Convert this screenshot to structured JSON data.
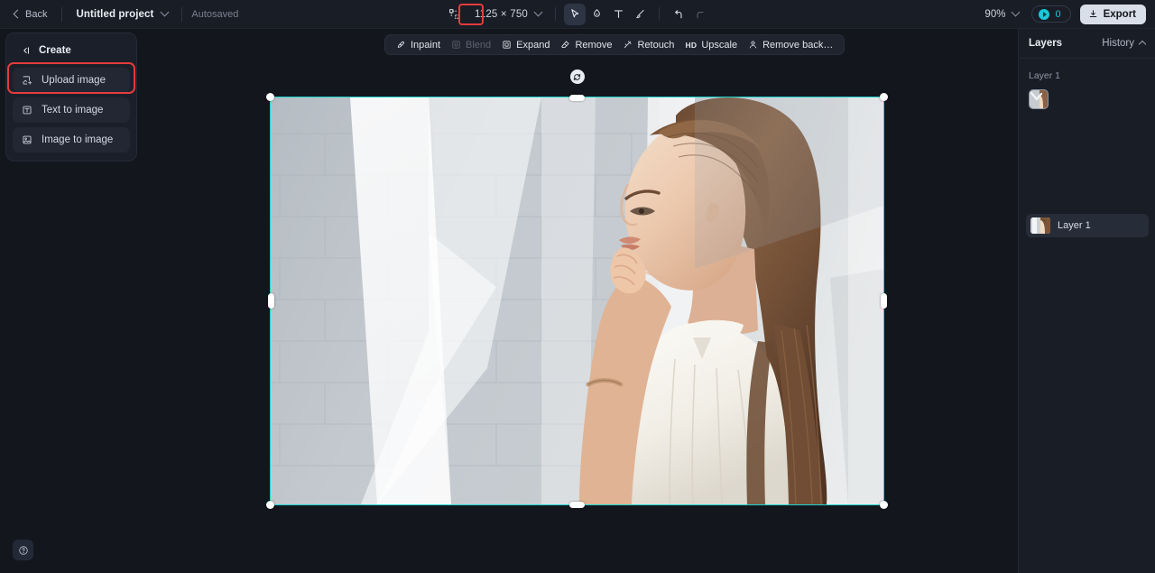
{
  "app": {
    "background": "#13161d",
    "accent": "#1ed4cf",
    "highlight_color": "#e33c3c"
  },
  "topbar": {
    "back_label": "Back",
    "project_name": "Untitled project",
    "autosaved_label": "Autosaved",
    "canvas_size_icon": "artboard-resize-icon",
    "canvas_size": "1125 × 750",
    "tools": [
      {
        "name": "select-tool",
        "icon": "cursor-icon",
        "active": true
      },
      {
        "name": "shape-tool",
        "icon": "blob-icon",
        "active": false
      },
      {
        "name": "text-tool",
        "icon": "text-t-icon",
        "active": false
      },
      {
        "name": "brush-tool",
        "icon": "brush-icon",
        "active": false
      }
    ],
    "undo_icon": "undo-arrow-icon",
    "redo_icon": "redo-arrow-icon",
    "zoom_level": "90%",
    "credits_count": "0",
    "export_label": "Export"
  },
  "create_panel": {
    "title": "Create",
    "collapse_icon": "collapse-panel-icon",
    "items": [
      {
        "label": "Upload image",
        "icon": "upload-image-icon",
        "highlighted": true
      },
      {
        "label": "Text to image",
        "icon": "text-to-image-icon",
        "highlighted": false
      },
      {
        "label": "Image to image",
        "icon": "image-to-image-icon",
        "highlighted": false
      }
    ]
  },
  "action_bar": {
    "actions": [
      {
        "label": "Inpaint",
        "icon": "inpaint-icon",
        "disabled": false
      },
      {
        "label": "Blend",
        "icon": "blend-icon",
        "disabled": true
      },
      {
        "label": "Expand",
        "icon": "expand-icon",
        "disabled": false
      },
      {
        "label": "Remove",
        "icon": "eraser-icon",
        "disabled": false
      },
      {
        "label": "Retouch",
        "icon": "retouch-icon",
        "disabled": false
      },
      {
        "label": "Upscale",
        "icon": "hd-icon",
        "badge": "HD",
        "disabled": false
      },
      {
        "label": "Remove back…",
        "icon": "remove-background-icon",
        "disabled": false
      }
    ]
  },
  "canvas": {
    "rotate_handle_icon": "rotate-icon",
    "selection_active": true,
    "image_description": "Woman with long brown hair in white sleeveless top, hand near chin, white brick wall with sunlight shadows"
  },
  "layers_panel": {
    "title": "Layers",
    "history_label": "History",
    "history_chevron_icon": "chevron-up-icon",
    "section_label": "Layer 1",
    "layers": [
      {
        "label": "Layer 1",
        "selected": true
      }
    ]
  },
  "help": {
    "icon": "help-question-icon"
  }
}
